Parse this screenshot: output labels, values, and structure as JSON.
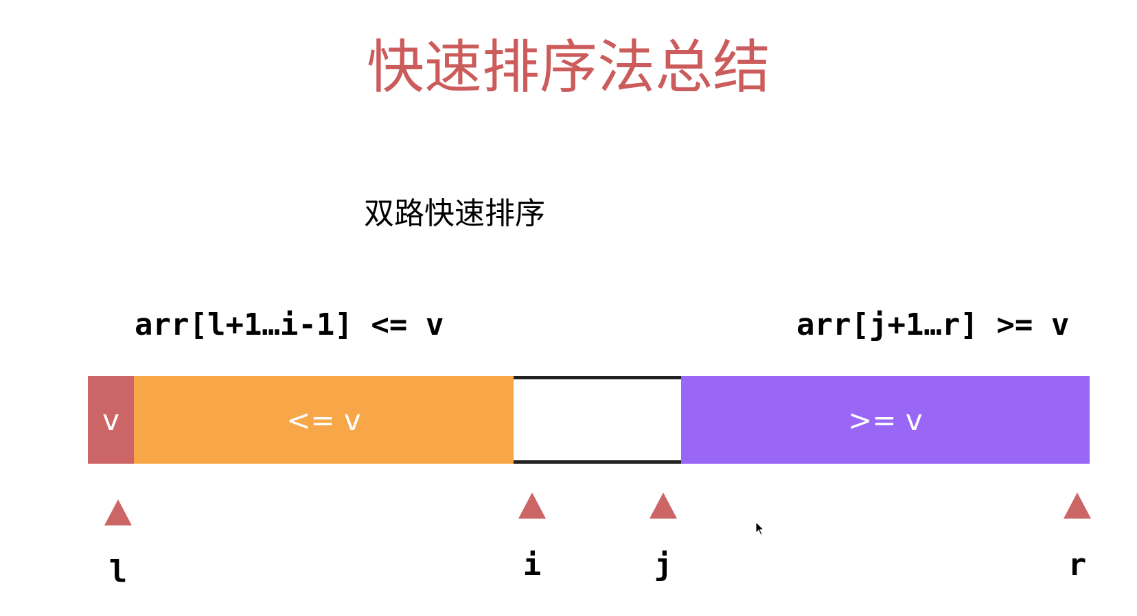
{
  "title": "快速排序法总结",
  "subtitle": "双路快速排序",
  "labels": {
    "left_range": "arr[l+1…i-1] <= v",
    "right_range": "arr[j+1…r] >= v"
  },
  "segments": {
    "pivot": {
      "text": "v",
      "color": "#cc6666"
    },
    "less_equal": {
      "text": "<= v",
      "color": "#f7a648"
    },
    "unknown": {
      "text": "",
      "color": "#ffffff"
    },
    "greater_equal": {
      "text": ">= v",
      "color": "#9966f5"
    }
  },
  "pointers": {
    "l": "l",
    "i": "i",
    "j": "j",
    "r": "r"
  },
  "colors": {
    "title": "#cc5b5b",
    "marker": "#cc6666"
  }
}
